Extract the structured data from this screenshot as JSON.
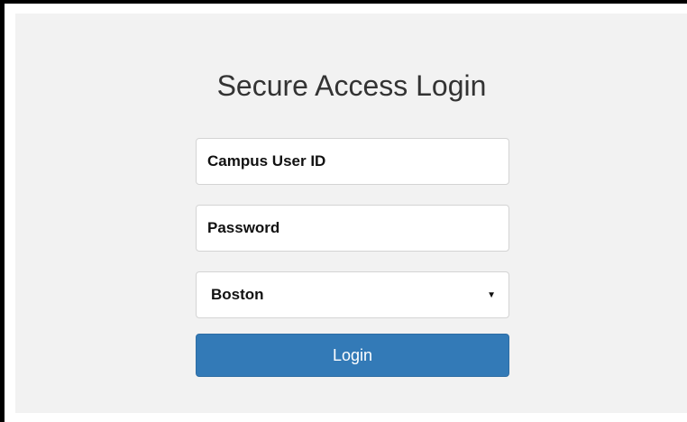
{
  "form": {
    "title": "Secure Access Login",
    "userid_placeholder": "Campus User ID",
    "password_placeholder": "Password",
    "campus_selected": "Boston",
    "login_label": "Login"
  },
  "icons": {
    "dropdown": "chevron-down-icon"
  },
  "colors": {
    "background": "#f2f2f2",
    "primary_button": "#337ab7",
    "frame_border": "#000000"
  }
}
